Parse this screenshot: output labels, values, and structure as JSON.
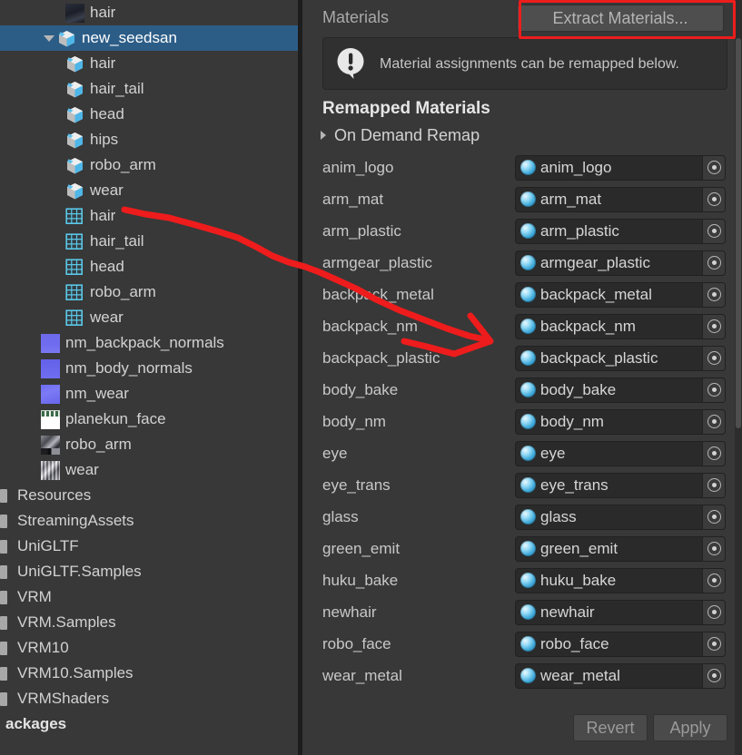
{
  "project_panel": {
    "items": [
      {
        "label": "hair",
        "icon": "texture-hair-icon",
        "indent": 2,
        "type": "texture-hair",
        "selected": false,
        "foldout": "none"
      },
      {
        "label": "new_seedsan",
        "icon": "prefab-icon",
        "indent": 1,
        "type": "prefab",
        "selected": true,
        "foldout": "open"
      },
      {
        "label": "hair",
        "icon": "prefab-icon",
        "indent": 2,
        "type": "prefab",
        "selected": false,
        "foldout": "none"
      },
      {
        "label": "hair_tail",
        "icon": "prefab-icon",
        "indent": 2,
        "type": "prefab",
        "selected": false,
        "foldout": "none"
      },
      {
        "label": "head",
        "icon": "prefab-icon",
        "indent": 2,
        "type": "prefab",
        "selected": false,
        "foldout": "none"
      },
      {
        "label": "hips",
        "icon": "prefab-icon",
        "indent": 2,
        "type": "prefab",
        "selected": false,
        "foldout": "none"
      },
      {
        "label": "robo_arm",
        "icon": "prefab-icon",
        "indent": 2,
        "type": "prefab",
        "selected": false,
        "foldout": "none"
      },
      {
        "label": "wear",
        "icon": "prefab-icon",
        "indent": 2,
        "type": "prefab",
        "selected": false,
        "foldout": "none"
      },
      {
        "label": "hair",
        "icon": "mesh-icon",
        "indent": 2,
        "type": "mesh",
        "selected": false,
        "foldout": "none"
      },
      {
        "label": "hair_tail",
        "icon": "mesh-icon",
        "indent": 2,
        "type": "mesh",
        "selected": false,
        "foldout": "none"
      },
      {
        "label": "head",
        "icon": "mesh-icon",
        "indent": 2,
        "type": "mesh",
        "selected": false,
        "foldout": "none"
      },
      {
        "label": "robo_arm",
        "icon": "mesh-icon",
        "indent": 2,
        "type": "mesh",
        "selected": false,
        "foldout": "none"
      },
      {
        "label": "wear",
        "icon": "mesh-icon",
        "indent": 2,
        "type": "mesh",
        "selected": false,
        "foldout": "none"
      },
      {
        "label": "nm_backpack_normals",
        "icon": "texture-normalmap-icon",
        "indent": 1,
        "type": "tex-normal",
        "selected": false,
        "foldout": "none"
      },
      {
        "label": "nm_body_normals",
        "icon": "texture-normalmap-icon",
        "indent": 1,
        "type": "tex-normal2",
        "selected": false,
        "foldout": "none"
      },
      {
        "label": "nm_wear",
        "icon": "texture-normalmap-icon",
        "indent": 1,
        "type": "tex-wearnm",
        "selected": false,
        "foldout": "none"
      },
      {
        "label": "planekun_face",
        "icon": "texture-icon",
        "indent": 1,
        "type": "tex-face",
        "selected": false,
        "foldout": "none"
      },
      {
        "label": "robo_arm",
        "icon": "texture-icon",
        "indent": 1,
        "type": "tex-robo",
        "selected": false,
        "foldout": "none"
      },
      {
        "label": "wear",
        "icon": "texture-icon",
        "indent": 1,
        "type": "tex-wear",
        "selected": false,
        "foldout": "none"
      },
      {
        "label": "Resources",
        "icon": "folder-icon",
        "indent": 0,
        "type": "folder",
        "selected": false,
        "foldout": "none"
      },
      {
        "label": "StreamingAssets",
        "icon": "folder-icon",
        "indent": 0,
        "type": "folder",
        "selected": false,
        "foldout": "none"
      },
      {
        "label": "UniGLTF",
        "icon": "folder-icon",
        "indent": 0,
        "type": "folder",
        "selected": false,
        "foldout": "none"
      },
      {
        "label": "UniGLTF.Samples",
        "icon": "folder-icon",
        "indent": 0,
        "type": "folder",
        "selected": false,
        "foldout": "none"
      },
      {
        "label": "VRM",
        "icon": "folder-icon",
        "indent": 0,
        "type": "folder",
        "selected": false,
        "foldout": "none"
      },
      {
        "label": "VRM.Samples",
        "icon": "folder-icon",
        "indent": 0,
        "type": "folder",
        "selected": false,
        "foldout": "none"
      },
      {
        "label": "VRM10",
        "icon": "folder-icon",
        "indent": 0,
        "type": "folder",
        "selected": false,
        "foldout": "none"
      },
      {
        "label": "VRM10.Samples",
        "icon": "folder-icon",
        "indent": 0,
        "type": "folder",
        "selected": false,
        "foldout": "none"
      },
      {
        "label": "VRMShaders",
        "icon": "folder-icon",
        "indent": 0,
        "type": "folder",
        "selected": false,
        "foldout": "none"
      },
      {
        "label": "ackages",
        "icon": "none",
        "indent": 0,
        "type": "root",
        "selected": false,
        "foldout": "none",
        "bold": true
      }
    ]
  },
  "inspector": {
    "materials_title": "Materials",
    "extract_button": "Extract Materials...",
    "info_message": "Material assignments can be remapped below.",
    "remapped_title": "Remapped Materials",
    "on_demand_remap": "On Demand Remap",
    "material_rows": [
      {
        "name": "anim_logo",
        "value": "anim_logo"
      },
      {
        "name": "arm_mat",
        "value": "arm_mat"
      },
      {
        "name": "arm_plastic",
        "value": "arm_plastic"
      },
      {
        "name": "armgear_plastic",
        "value": "armgear_plastic"
      },
      {
        "name": "backpack_metal",
        "value": "backpack_metal"
      },
      {
        "name": "backpack_nm",
        "value": "backpack_nm"
      },
      {
        "name": "backpack_plastic",
        "value": "backpack_plastic"
      },
      {
        "name": "body_bake",
        "value": "body_bake"
      },
      {
        "name": "body_nm",
        "value": "body_nm"
      },
      {
        "name": "eye",
        "value": "eye"
      },
      {
        "name": "eye_trans",
        "value": "eye_trans"
      },
      {
        "name": "glass",
        "value": "glass"
      },
      {
        "name": "green_emit",
        "value": "green_emit"
      },
      {
        "name": "huku_bake",
        "value": "huku_bake"
      },
      {
        "name": "newhair",
        "value": "newhair"
      },
      {
        "name": "robo_face",
        "value": "robo_face"
      },
      {
        "name": "wear_metal",
        "value": "wear_metal"
      }
    ],
    "revert_button": "Revert",
    "apply_button": "Apply"
  },
  "annotation": {
    "highlight_color": "#ee1c1c",
    "arrow_color": "#ee1c1c"
  }
}
